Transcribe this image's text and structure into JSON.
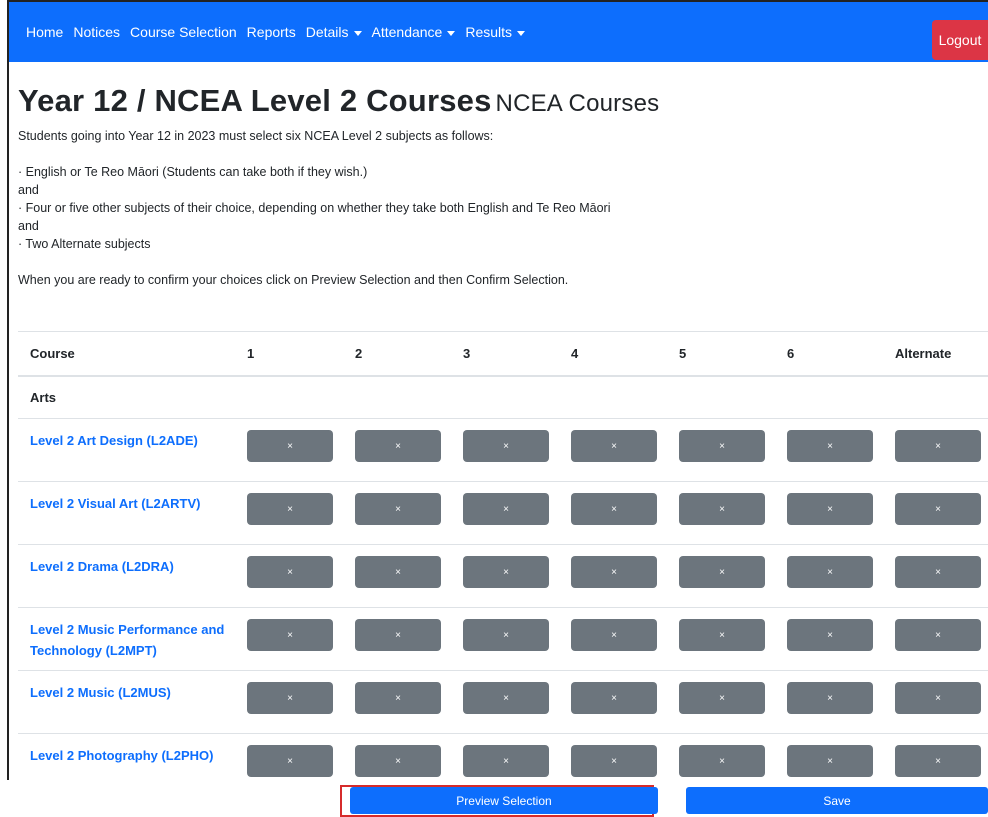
{
  "nav": {
    "items": [
      {
        "label": "Home",
        "dropdown": false
      },
      {
        "label": "Notices",
        "dropdown": false
      },
      {
        "label": "Course Selection",
        "dropdown": false
      },
      {
        "label": "Reports",
        "dropdown": false
      },
      {
        "label": "Details",
        "dropdown": true
      },
      {
        "label": "Attendance",
        "dropdown": true
      },
      {
        "label": "Results",
        "dropdown": true
      }
    ],
    "logout_label": "Logout"
  },
  "page": {
    "title": "Year 12 / NCEA Level 2 Courses",
    "subtitle": "NCEA Courses",
    "intro": "Students going into Year 12 in 2023 must select six NCEA Level 2 subjects as follows:",
    "rule1": "· English or Te Reo Māori (Students can take both if they wish.)",
    "and1": "and",
    "rule2": "· Four or five other subjects of their choice, depending on whether they take both English and Te Reo Māori",
    "and2": "and",
    "rule3": "· Two Alternate subjects",
    "confirm_text": "When you are ready to confirm your choices click on Preview Selection and then Confirm Selection."
  },
  "table": {
    "headers": [
      "Course",
      "1",
      "2",
      "3",
      "4",
      "5",
      "6",
      "Alternate"
    ],
    "group": "Arts",
    "button_glyph": "×",
    "courses": [
      "Level 2 Art Design (L2ADE)",
      "Level 2 Visual Art (L2ARTV)",
      "Level 2 Drama (L2DRA)",
      "Level 2 Music Performance and Technology (L2MPT)",
      "Level 2 Music (L2MUS)",
      "Level 2 Photography (L2PHO)"
    ]
  },
  "footer": {
    "preview_label": "Preview Selection",
    "save_label": "Save"
  },
  "colors": {
    "primary": "#0d6efd",
    "danger": "#dc3545",
    "secondary": "#6c757d",
    "highlight": "#d62b2b"
  }
}
